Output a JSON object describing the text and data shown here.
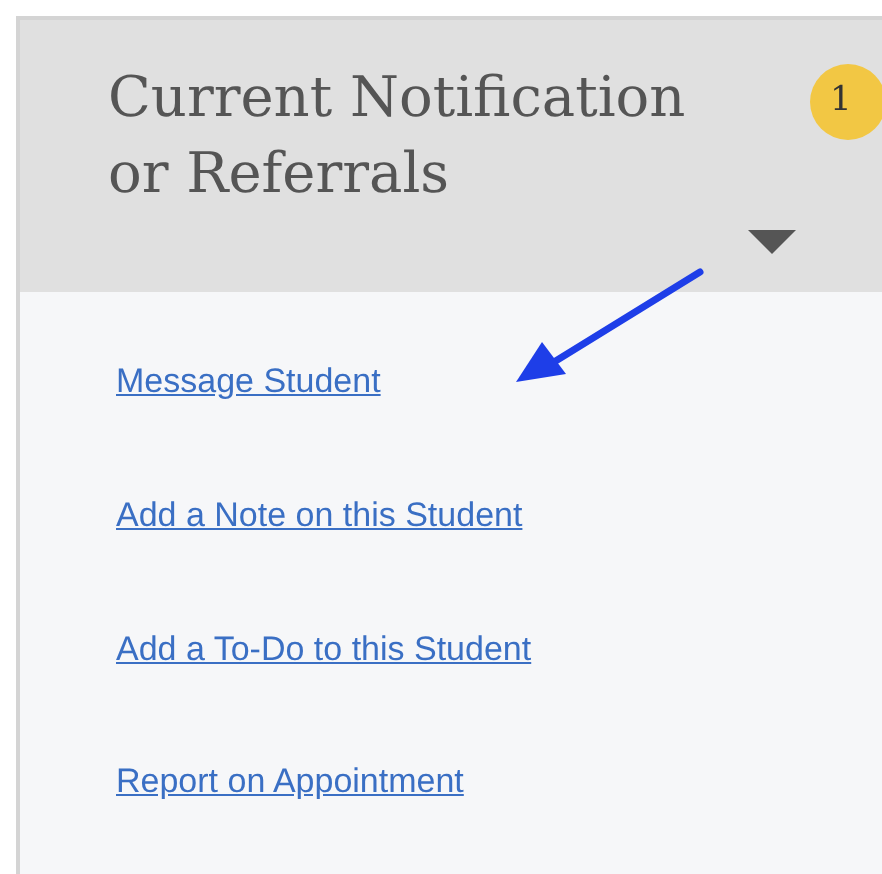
{
  "panel": {
    "title": "Current Notification or Referrals",
    "badge": "1",
    "expanded": true
  },
  "links": [
    {
      "label": "Message Student"
    },
    {
      "label": "Add a Note on this Student"
    },
    {
      "label": "Add a To-Do to this Student"
    },
    {
      "label": "Report on Appointment"
    }
  ]
}
